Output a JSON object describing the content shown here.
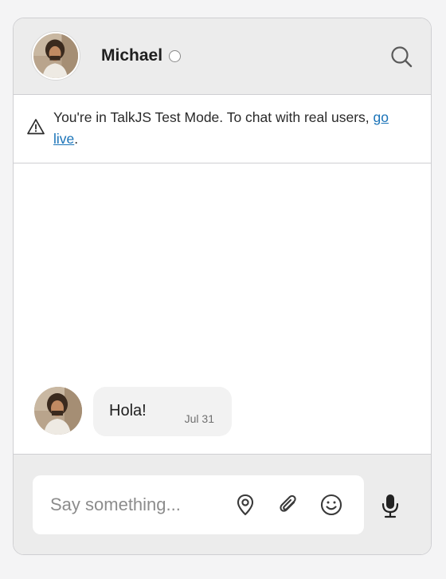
{
  "header": {
    "name": "Michael",
    "status": "offline",
    "icons": {
      "search": "search-icon",
      "status": "status-dot-icon"
    }
  },
  "notice": {
    "text_before": "You're in TalkJS Test Mode. To chat with real users, ",
    "link_text": "go live",
    "text_after": ".",
    "icon": "warning-icon"
  },
  "messages": [
    {
      "sender": "Michael",
      "text": "Hola!",
      "time": "Jul 31"
    }
  ],
  "composer": {
    "placeholder": "Say something...",
    "icons": [
      "location-icon",
      "attachment-icon",
      "emoji-icon",
      "microphone-icon"
    ]
  },
  "colors": {
    "link": "#1a73b8",
    "header_bg": "#ececec",
    "bubble_bg": "#f2f2f2"
  }
}
